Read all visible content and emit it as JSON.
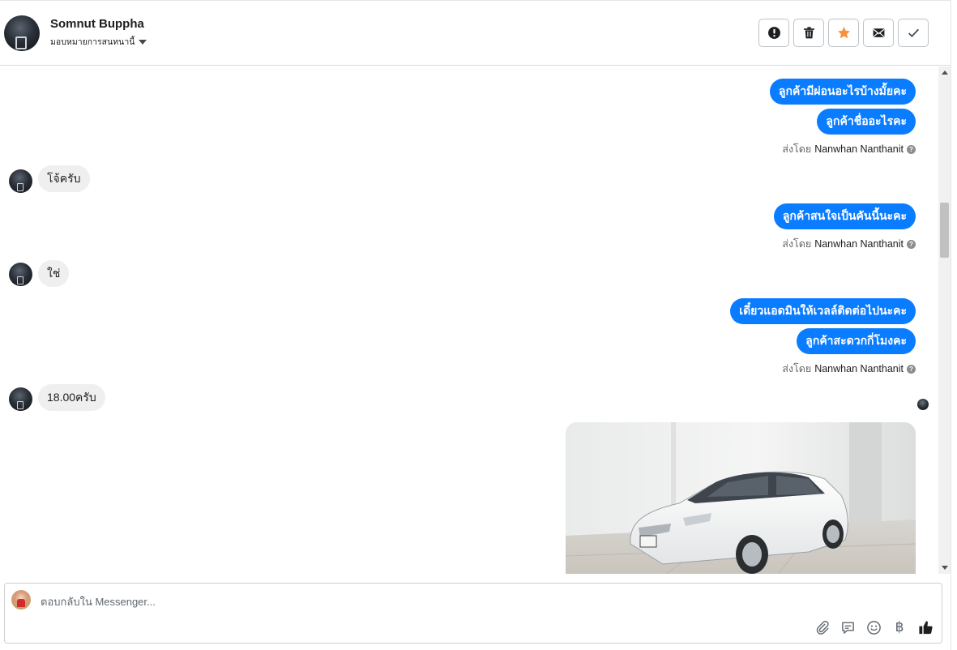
{
  "header": {
    "contact_name": "Somnut Buppha",
    "assign_label": "มอบหมายการสนทนานี้",
    "actions": [
      {
        "name": "mark-spam",
        "icon": "exclamation-icon"
      },
      {
        "name": "delete",
        "icon": "trash-icon"
      },
      {
        "name": "star",
        "icon": "star-icon",
        "color": "#f7923a"
      },
      {
        "name": "mark-unread",
        "icon": "envelope-icon"
      },
      {
        "name": "mark-done",
        "icon": "checkmark-icon"
      }
    ]
  },
  "messages": {
    "group1": {
      "outgoing": [
        "ลูกค้ามีผ่อนอะไรบ้างมั้ยคะ",
        "ลูกค้าชื่ออะไรคะ"
      ],
      "sent_by_prefix": "ส่งโดย",
      "sent_by_name": "Nanwhan Nanthanit"
    },
    "incoming1": "โจ้ครับ",
    "group2": {
      "outgoing": [
        "ลูกค้าสนใจเป็นคันนี้นะคะ"
      ],
      "sent_by_prefix": "ส่งโดย",
      "sent_by_name": "Nanwhan Nanthanit"
    },
    "incoming2": "ใช่",
    "group3": {
      "outgoing": [
        "เดี๋ยวแอดมินให้เวลล์ติดต่อไปนะคะ",
        "ลูกค้าสะดวกกี่โมงคะ"
      ],
      "sent_by_prefix": "ส่งโดย",
      "sent_by_name": "Nanwhan Nanthanit"
    },
    "incoming3": "18.00ครับ"
  },
  "composer": {
    "placeholder": "ตอบกลับใน Messenger...",
    "icons": [
      "paperclip-icon",
      "saved-reply-icon",
      "emoji-icon",
      "payment-baht-icon",
      "thumbs-up-icon"
    ],
    "baht_symbol": "฿"
  },
  "colors": {
    "outgoing_bubble": "#0a7cff",
    "incoming_bubble": "#efefef",
    "star": "#f7923a"
  }
}
